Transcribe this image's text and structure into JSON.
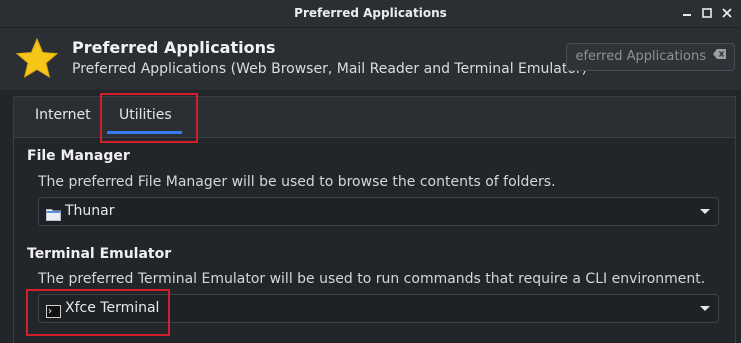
{
  "window": {
    "title": "Preferred Applications",
    "controls": [
      "minimize-icon",
      "maximize-icon",
      "close-icon"
    ]
  },
  "header": {
    "icon": "star-icon",
    "title": "Preferred Applications",
    "subtitle": "Preferred Applications (Web Browser, Mail Reader and Terminal Emulator)",
    "search": {
      "value": "eferred Applications",
      "clear_icon": "clear-icon"
    }
  },
  "tabs": [
    {
      "label": "Internet",
      "selected": false
    },
    {
      "label": "Utilities",
      "selected": true
    }
  ],
  "sections": {
    "file_manager": {
      "title": "File Manager",
      "description": "The preferred File Manager will be used to browse the contents of folders.",
      "selected": "Thunar",
      "icon": "folder-icon"
    },
    "terminal": {
      "title": "Terminal Emulator",
      "description": "The preferred Terminal Emulator will be used to run commands that require a CLI environment.",
      "selected": "Xfce Terminal",
      "icon": "terminal-icon"
    }
  },
  "colors": {
    "accent": "#367bf0",
    "highlight_box": "#d0202c",
    "star": "#f5c518"
  }
}
